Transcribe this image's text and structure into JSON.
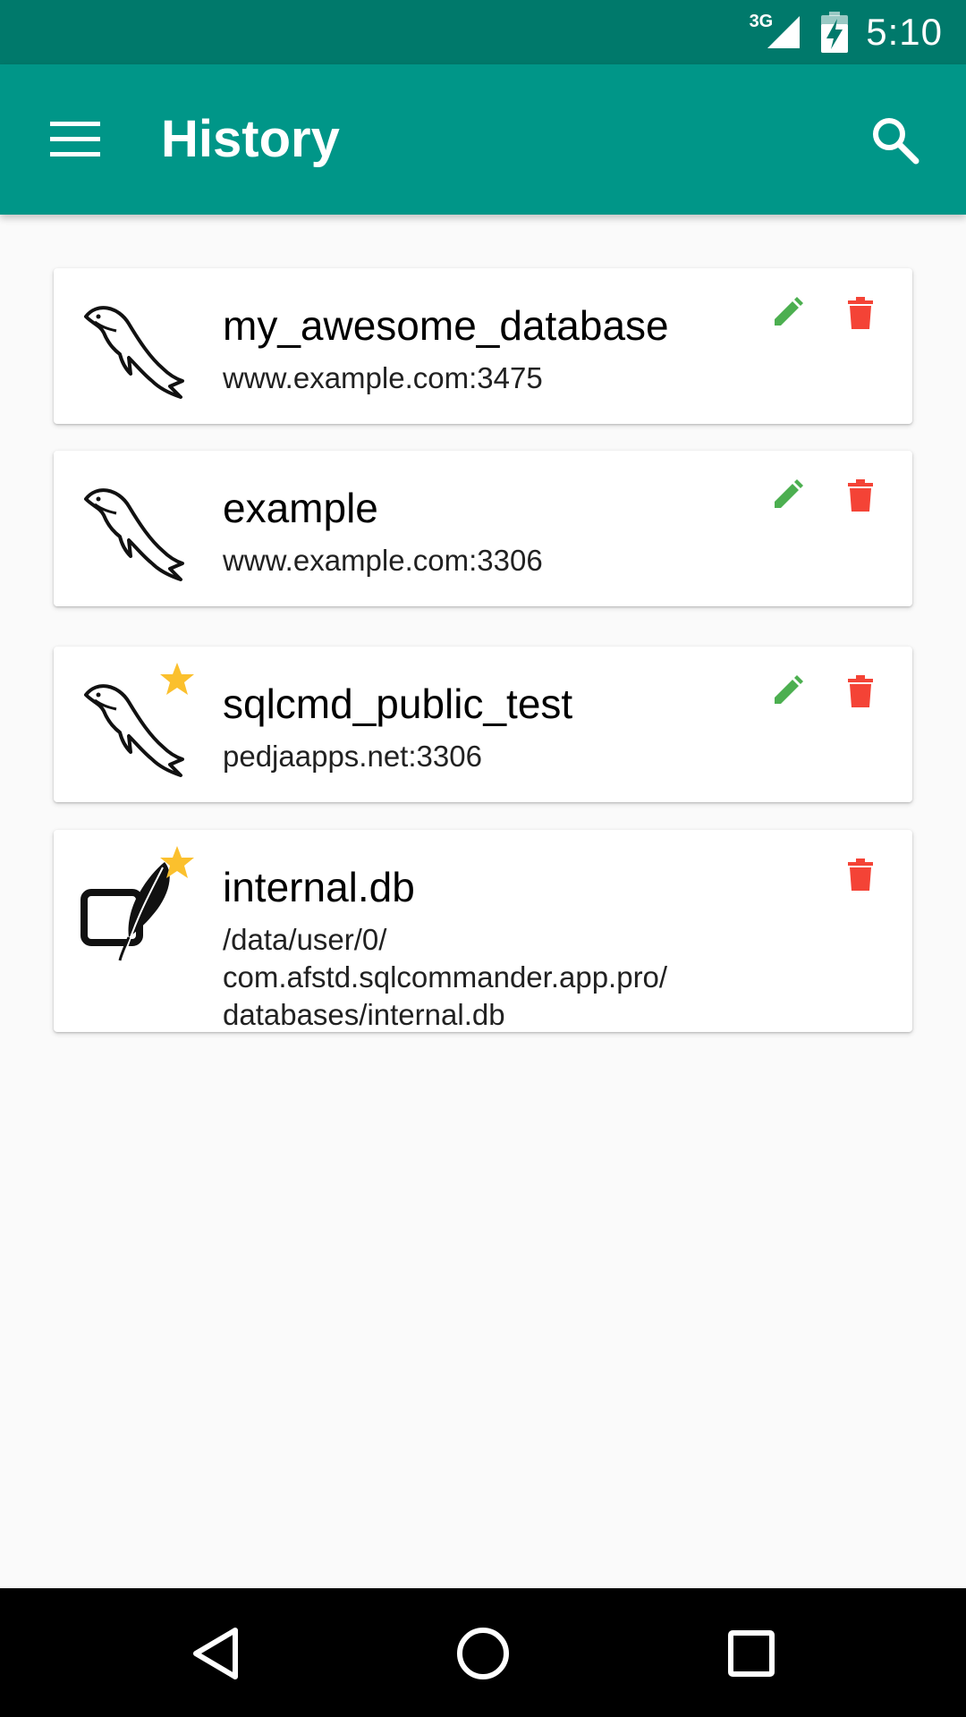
{
  "status_bar": {
    "network": "3G",
    "time": "5:10",
    "icons": [
      "signal-icon",
      "battery-charging-icon"
    ]
  },
  "app_bar": {
    "title": "History",
    "color": "#009688",
    "icons": [
      "hamburger-menu-icon",
      "search-icon"
    ]
  },
  "connections": [
    {
      "title": "my_awesome_database",
      "subtitle": "www.example.com:3475",
      "db_icon": "mysql-dolphin-icon",
      "favorite": false,
      "editable": true
    },
    {
      "title": "example",
      "subtitle": "www.example.com:3306",
      "db_icon": "mysql-dolphin-icon",
      "favorite": false,
      "editable": true
    },
    {
      "title": "sqlcmd_public_test",
      "subtitle": "pedjaapps.net:3306",
      "db_icon": "mysql-dolphin-icon",
      "favorite": true,
      "editable": true
    },
    {
      "title": "internal.db",
      "subtitle_lines": [
        "/data/user/0/",
        "com.afstd.sqlcommander.app.pro/",
        "databases/internal.db"
      ],
      "db_icon": "sqlite-feather-icon",
      "favorite": true,
      "editable": false
    }
  ],
  "colors": {
    "edit": "#4caf50",
    "delete": "#f44336",
    "star": "#fbc02d",
    "status_bar": "#00796b"
  },
  "nav_bar": {
    "icons": [
      "back-icon",
      "home-icon",
      "recents-icon"
    ]
  }
}
